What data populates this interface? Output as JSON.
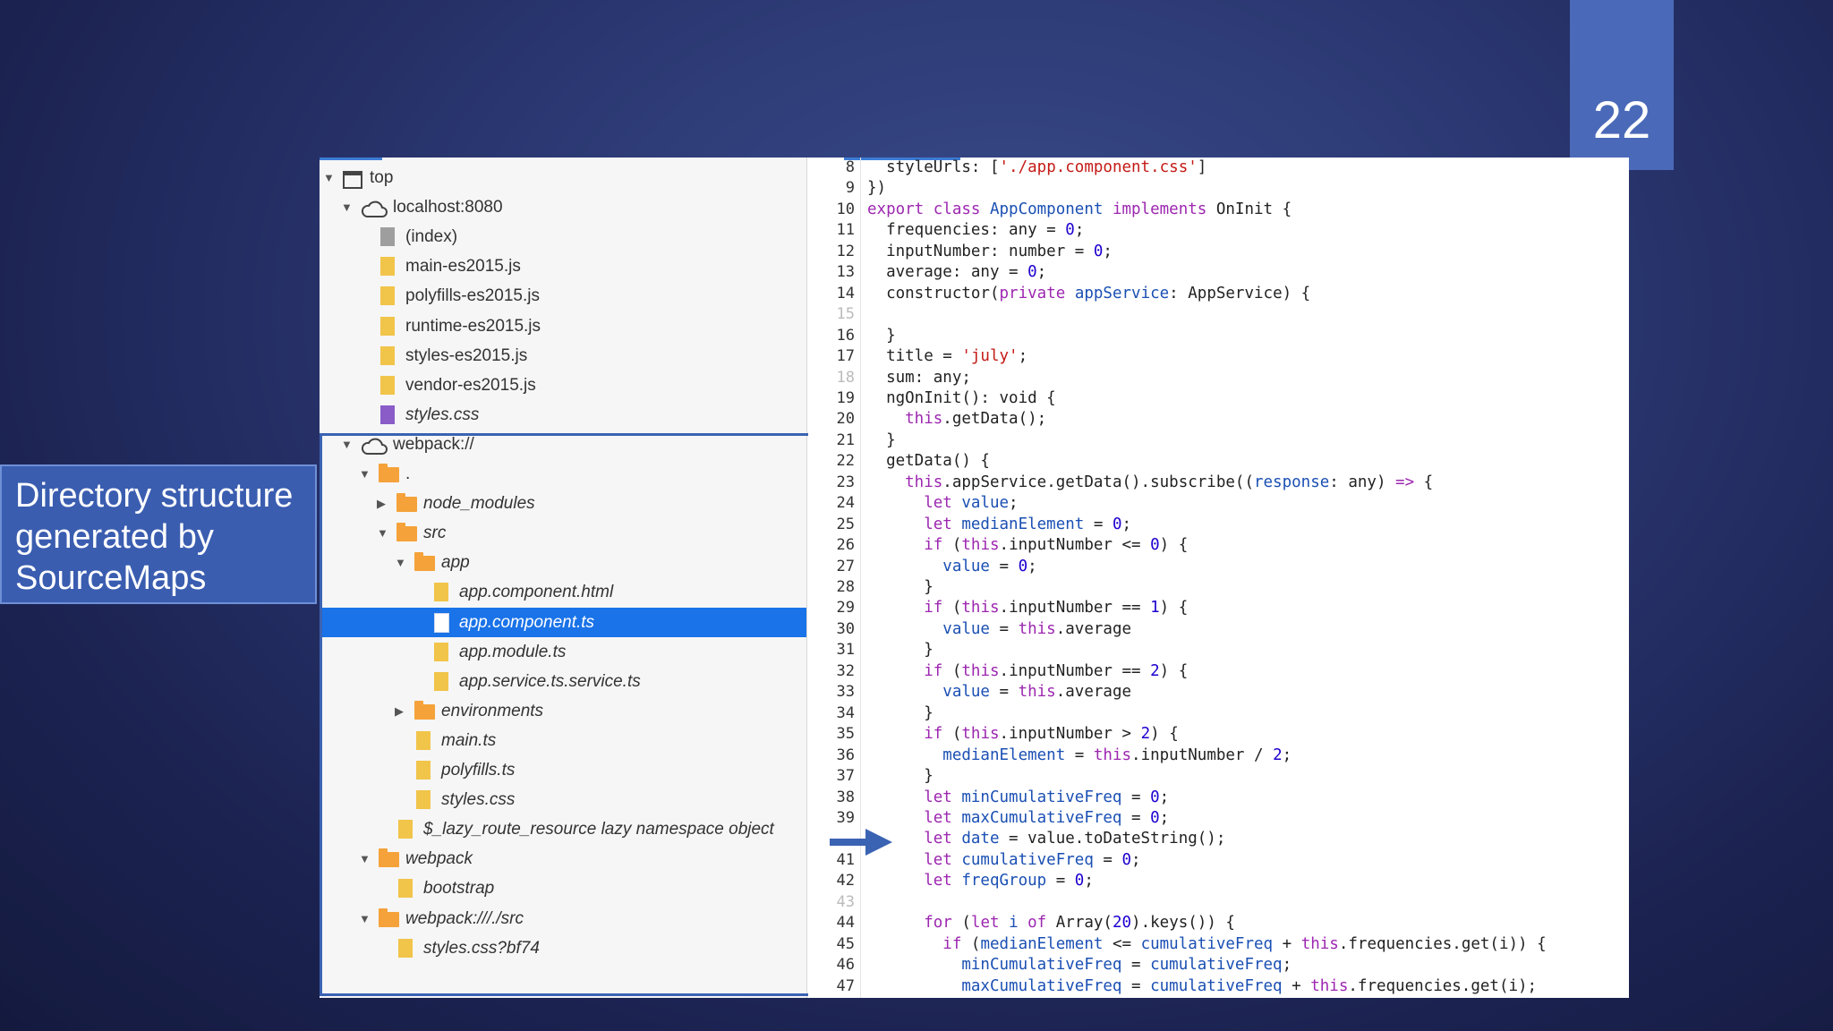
{
  "slide": {
    "number": "22"
  },
  "caption": {
    "text": "Directory structure generated by SourceMaps"
  },
  "tree": [
    {
      "label": "top",
      "indent": 0,
      "arrow": "down",
      "icon": "frame",
      "italic": false
    },
    {
      "label": "localhost:8080",
      "indent": 1,
      "arrow": "down",
      "icon": "cloud",
      "italic": false
    },
    {
      "label": "(index)",
      "indent": 2,
      "arrow": "",
      "icon": "file-gray",
      "italic": false
    },
    {
      "label": "main-es2015.js",
      "indent": 2,
      "arrow": "",
      "icon": "file-yellow",
      "italic": false
    },
    {
      "label": "polyfills-es2015.js",
      "indent": 2,
      "arrow": "",
      "icon": "file-yellow",
      "italic": false
    },
    {
      "label": "runtime-es2015.js",
      "indent": 2,
      "arrow": "",
      "icon": "file-yellow",
      "italic": false
    },
    {
      "label": "styles-es2015.js",
      "indent": 2,
      "arrow": "",
      "icon": "file-yellow",
      "italic": false
    },
    {
      "label": "vendor-es2015.js",
      "indent": 2,
      "arrow": "",
      "icon": "file-yellow",
      "italic": false
    },
    {
      "label": "styles.css",
      "indent": 2,
      "arrow": "",
      "icon": "file-purple",
      "italic": true
    },
    {
      "label": "webpack://",
      "indent": 1,
      "arrow": "down",
      "icon": "cloud",
      "italic": false
    },
    {
      "label": ".",
      "indent": 2,
      "arrow": "down",
      "icon": "folder",
      "italic": false
    },
    {
      "label": "node_modules",
      "indent": 3,
      "arrow": "right",
      "icon": "folder",
      "italic": true
    },
    {
      "label": "src",
      "indent": 3,
      "arrow": "down",
      "icon": "folder",
      "italic": true
    },
    {
      "label": "app",
      "indent": 4,
      "arrow": "down",
      "icon": "folder",
      "italic": true
    },
    {
      "label": "app.component.html",
      "indent": 5,
      "arrow": "",
      "icon": "file-yellow",
      "italic": true
    },
    {
      "label": "app.component.ts",
      "indent": 5,
      "arrow": "",
      "icon": "file-white",
      "italic": true,
      "selected": true
    },
    {
      "label": "app.module.ts",
      "indent": 5,
      "arrow": "",
      "icon": "file-yellow",
      "italic": true
    },
    {
      "label": "app.service.ts.service.ts",
      "indent": 5,
      "arrow": "",
      "icon": "file-yellow",
      "italic": true
    },
    {
      "label": "environments",
      "indent": 4,
      "arrow": "right",
      "icon": "folder",
      "italic": true
    },
    {
      "label": "main.ts",
      "indent": 4,
      "arrow": "",
      "icon": "file-yellow",
      "italic": true
    },
    {
      "label": "polyfills.ts",
      "indent": 4,
      "arrow": "",
      "icon": "file-yellow",
      "italic": true
    },
    {
      "label": "styles.css",
      "indent": 4,
      "arrow": "",
      "icon": "file-yellow",
      "italic": true
    },
    {
      "label": "$_lazy_route_resource lazy namespace object",
      "indent": 3,
      "arrow": "",
      "icon": "file-yellow",
      "italic": true
    },
    {
      "label": "webpack",
      "indent": 2,
      "arrow": "down",
      "icon": "folder",
      "italic": true
    },
    {
      "label": "bootstrap",
      "indent": 3,
      "arrow": "",
      "icon": "file-yellow",
      "italic": true
    },
    {
      "label": "webpack:///./src",
      "indent": 2,
      "arrow": "down",
      "icon": "folder",
      "italic": true
    },
    {
      "label": "styles.css?bf74",
      "indent": 3,
      "arrow": "",
      "icon": "file-yellow",
      "italic": true
    }
  ],
  "code": [
    {
      "n": "8",
      "dim": false,
      "t": [
        [
          "vr",
          "  styleUrls: ["
        ],
        [
          "st",
          "'./app.component.css'"
        ],
        [
          "vr",
          "]"
        ]
      ]
    },
    {
      "n": "9",
      "dim": false,
      "t": [
        [
          "vr",
          "})"
        ]
      ]
    },
    {
      "n": "10",
      "dim": false,
      "t": [
        [
          "kw",
          "export class "
        ],
        [
          "cl",
          "AppComponent "
        ],
        [
          "kw",
          "implements "
        ],
        [
          "vr",
          "OnInit {"
        ]
      ]
    },
    {
      "n": "11",
      "dim": false,
      "t": [
        [
          "vr",
          "  frequencies: any = "
        ],
        [
          "nm",
          "0"
        ],
        [
          "vr",
          ";"
        ]
      ]
    },
    {
      "n": "12",
      "dim": false,
      "t": [
        [
          "vr",
          "  inputNumber: number = "
        ],
        [
          "nm",
          "0"
        ],
        [
          "vr",
          ";"
        ]
      ]
    },
    {
      "n": "13",
      "dim": false,
      "t": [
        [
          "vr",
          "  average: any = "
        ],
        [
          "nm",
          "0"
        ],
        [
          "vr",
          ";"
        ]
      ]
    },
    {
      "n": "14",
      "dim": false,
      "t": [
        [
          "vr",
          "  constructor("
        ],
        [
          "kw",
          "private "
        ],
        [
          "tp",
          "appService"
        ],
        [
          "vr",
          ": AppService) {"
        ]
      ]
    },
    {
      "n": "15",
      "dim": true,
      "t": [
        [
          "vr",
          ""
        ]
      ]
    },
    {
      "n": "16",
      "dim": false,
      "t": [
        [
          "vr",
          "  }"
        ]
      ]
    },
    {
      "n": "17",
      "dim": false,
      "t": [
        [
          "vr",
          "  title = "
        ],
        [
          "st",
          "'july'"
        ],
        [
          "vr",
          ";"
        ]
      ]
    },
    {
      "n": "18",
      "dim": true,
      "t": [
        [
          "vr",
          "  sum: any;"
        ]
      ]
    },
    {
      "n": "19",
      "dim": false,
      "t": [
        [
          "vr",
          "  ngOnInit(): void {"
        ]
      ]
    },
    {
      "n": "20",
      "dim": false,
      "t": [
        [
          "kw",
          "    this"
        ],
        [
          "vr",
          ".getData();"
        ]
      ]
    },
    {
      "n": "21",
      "dim": false,
      "t": [
        [
          "vr",
          "  }"
        ]
      ]
    },
    {
      "n": "22",
      "dim": false,
      "t": [
        [
          "vr",
          "  getData() {"
        ]
      ]
    },
    {
      "n": "23",
      "dim": false,
      "t": [
        [
          "kw",
          "    this"
        ],
        [
          "vr",
          ".appService.getData().subscribe(("
        ],
        [
          "tp",
          "response"
        ],
        [
          "vr",
          ": any) "
        ],
        [
          "kw",
          "=>"
        ],
        [
          "vr",
          " {"
        ]
      ]
    },
    {
      "n": "24",
      "dim": false,
      "t": [
        [
          "kw",
          "      let "
        ],
        [
          "tp",
          "value"
        ],
        [
          "vr",
          ";"
        ]
      ]
    },
    {
      "n": "25",
      "dim": false,
      "t": [
        [
          "kw",
          "      let "
        ],
        [
          "tp",
          "medianElement"
        ],
        [
          "vr",
          " = "
        ],
        [
          "nm",
          "0"
        ],
        [
          "vr",
          ";"
        ]
      ]
    },
    {
      "n": "26",
      "dim": false,
      "t": [
        [
          "kw",
          "      if "
        ],
        [
          "vr",
          "("
        ],
        [
          "kw",
          "this"
        ],
        [
          "vr",
          ".inputNumber <= "
        ],
        [
          "nm",
          "0"
        ],
        [
          "vr",
          ") {"
        ]
      ]
    },
    {
      "n": "27",
      "dim": false,
      "t": [
        [
          "tp",
          "        value"
        ],
        [
          "vr",
          " = "
        ],
        [
          "nm",
          "0"
        ],
        [
          "vr",
          ";"
        ]
      ]
    },
    {
      "n": "28",
      "dim": false,
      "t": [
        [
          "vr",
          "      }"
        ]
      ]
    },
    {
      "n": "29",
      "dim": false,
      "t": [
        [
          "kw",
          "      if "
        ],
        [
          "vr",
          "("
        ],
        [
          "kw",
          "this"
        ],
        [
          "vr",
          ".inputNumber == "
        ],
        [
          "nm",
          "1"
        ],
        [
          "vr",
          ") {"
        ]
      ]
    },
    {
      "n": "30",
      "dim": false,
      "t": [
        [
          "tp",
          "        value"
        ],
        [
          "vr",
          " = "
        ],
        [
          "kw",
          "this"
        ],
        [
          "vr",
          ".average"
        ]
      ]
    },
    {
      "n": "31",
      "dim": false,
      "t": [
        [
          "vr",
          "      }"
        ]
      ]
    },
    {
      "n": "32",
      "dim": false,
      "t": [
        [
          "kw",
          "      if "
        ],
        [
          "vr",
          "("
        ],
        [
          "kw",
          "this"
        ],
        [
          "vr",
          ".inputNumber == "
        ],
        [
          "nm",
          "2"
        ],
        [
          "vr",
          ") {"
        ]
      ]
    },
    {
      "n": "33",
      "dim": false,
      "t": [
        [
          "tp",
          "        value"
        ],
        [
          "vr",
          " = "
        ],
        [
          "kw",
          "this"
        ],
        [
          "vr",
          ".average"
        ]
      ]
    },
    {
      "n": "34",
      "dim": false,
      "t": [
        [
          "vr",
          "      }"
        ]
      ]
    },
    {
      "n": "35",
      "dim": false,
      "t": [
        [
          "kw",
          "      if "
        ],
        [
          "vr",
          "("
        ],
        [
          "kw",
          "this"
        ],
        [
          "vr",
          ".inputNumber > "
        ],
        [
          "nm",
          "2"
        ],
        [
          "vr",
          ") {"
        ]
      ]
    },
    {
      "n": "36",
      "dim": false,
      "t": [
        [
          "tp",
          "        medianElement"
        ],
        [
          "vr",
          " = "
        ],
        [
          "kw",
          "this"
        ],
        [
          "vr",
          ".inputNumber / "
        ],
        [
          "nm",
          "2"
        ],
        [
          "vr",
          ";"
        ]
      ]
    },
    {
      "n": "37",
      "dim": false,
      "t": [
        [
          "vr",
          "      }"
        ]
      ]
    },
    {
      "n": "38",
      "dim": false,
      "t": [
        [
          "kw",
          "      let "
        ],
        [
          "tp",
          "minCumulativeFreq"
        ],
        [
          "vr",
          " = "
        ],
        [
          "nm",
          "0"
        ],
        [
          "vr",
          ";"
        ]
      ]
    },
    {
      "n": "39",
      "dim": false,
      "t": [
        [
          "kw",
          "      let "
        ],
        [
          "tp",
          "maxCumulativeFreq"
        ],
        [
          "vr",
          " = "
        ],
        [
          "nm",
          "0"
        ],
        [
          "vr",
          ";"
        ]
      ]
    },
    {
      "n": "",
      "dim": false,
      "t": [
        [
          "kw",
          "      let "
        ],
        [
          "tp",
          "date"
        ],
        [
          "vr",
          " = value.toDateString();"
        ]
      ]
    },
    {
      "n": "41",
      "dim": false,
      "t": [
        [
          "kw",
          "      let "
        ],
        [
          "tp",
          "cumulativeFreq"
        ],
        [
          "vr",
          " = "
        ],
        [
          "nm",
          "0"
        ],
        [
          "vr",
          ";"
        ]
      ]
    },
    {
      "n": "42",
      "dim": false,
      "t": [
        [
          "kw",
          "      let "
        ],
        [
          "tp",
          "freqGroup"
        ],
        [
          "vr",
          " = "
        ],
        [
          "nm",
          "0"
        ],
        [
          "vr",
          ";"
        ]
      ]
    },
    {
      "n": "43",
      "dim": true,
      "t": [
        [
          "vr",
          ""
        ]
      ]
    },
    {
      "n": "44",
      "dim": false,
      "t": [
        [
          "kw",
          "      for "
        ],
        [
          "vr",
          "("
        ],
        [
          "kw",
          "let "
        ],
        [
          "tp",
          "i "
        ],
        [
          "kw",
          "of "
        ],
        [
          "vr",
          "Array("
        ],
        [
          "nm",
          "20"
        ],
        [
          "vr",
          ").keys()) {"
        ]
      ]
    },
    {
      "n": "45",
      "dim": false,
      "t": [
        [
          "kw",
          "        if "
        ],
        [
          "vr",
          "("
        ],
        [
          "tp",
          "medianElement"
        ],
        [
          "vr",
          " <= "
        ],
        [
          "tp",
          "cumulativeFreq"
        ],
        [
          "vr",
          " + "
        ],
        [
          "kw",
          "this"
        ],
        [
          "vr",
          ".frequencies.get(i)) {"
        ]
      ]
    },
    {
      "n": "46",
      "dim": false,
      "t": [
        [
          "tp",
          "          minCumulativeFreq"
        ],
        [
          "vr",
          " = "
        ],
        [
          "tp",
          "cumulativeFreq"
        ],
        [
          "vr",
          ";"
        ]
      ]
    },
    {
      "n": "47",
      "dim": false,
      "t": [
        [
          "tp",
          "          maxCumulativeFreq"
        ],
        [
          "vr",
          " = "
        ],
        [
          "tp",
          "cumulativeFreq"
        ],
        [
          "vr",
          " + "
        ],
        [
          "kw",
          "this"
        ],
        [
          "vr",
          ".frequencies.get(i);"
        ]
      ]
    }
  ],
  "colors": {
    "accent": "#4a69b8",
    "selection": "#1a73e8",
    "frame": "#3b63b3"
  }
}
